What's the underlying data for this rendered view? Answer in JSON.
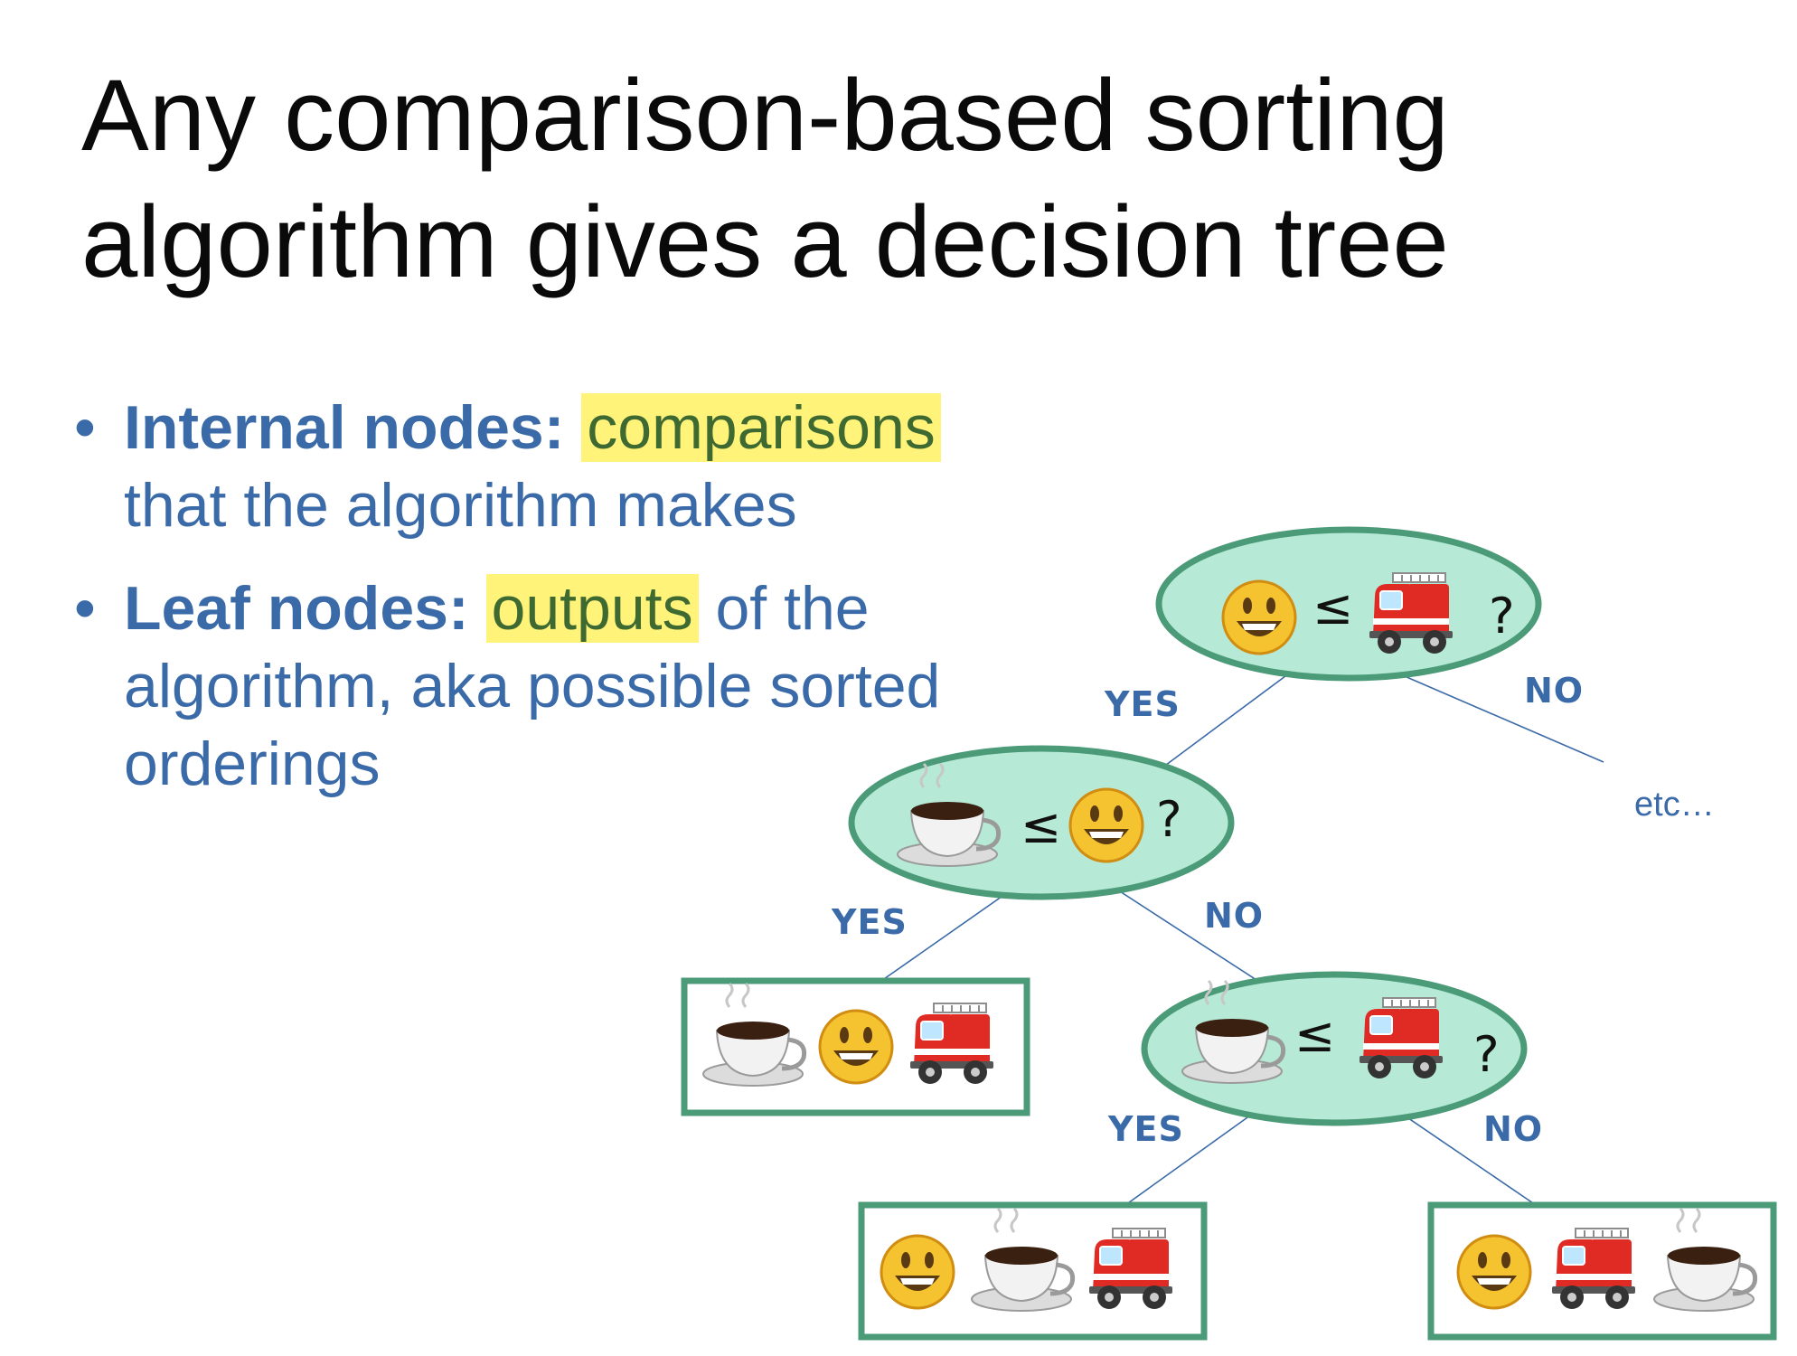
{
  "slide": {
    "title_lines": [
      "Any comparison-based sorting",
      "algorithm gives a decision tree"
    ],
    "bullets": [
      {
        "term": "Internal nodes:",
        "highlight": "comparisons",
        "rest_inline": "",
        "rest_lines": [
          "that the algorithm makes"
        ]
      },
      {
        "term": "Leaf nodes:",
        "highlight": "outputs",
        "rest_inline": " of the",
        "rest_lines": [
          "algorithm, aka possible sorted",
          "orderings"
        ]
      }
    ]
  },
  "tree": {
    "labels": {
      "yes": "YES",
      "no": "NO",
      "etc": "etc…",
      "leq": "≤",
      "question": "?"
    },
    "icon_names": {
      "smiley": "smiley-emoji-icon",
      "coffee": "coffee-cup-icon",
      "firetruck": "fire-engine-icon"
    },
    "colors": {
      "node_fill": "#b6ead6",
      "node_stroke": "#4b9a78",
      "edge": "#3a6aa8",
      "highlight": "#fff37a"
    },
    "comparisons": [
      {
        "left": "smiley",
        "right": "firetruck"
      },
      {
        "left": "coffee",
        "right": "smiley"
      },
      {
        "left": "coffee",
        "right": "firetruck"
      }
    ],
    "leaves": [
      [
        "coffee",
        "smiley",
        "firetruck"
      ],
      [
        "smiley",
        "coffee",
        "firetruck"
      ],
      [
        "smiley",
        "firetruck",
        "coffee"
      ]
    ]
  }
}
